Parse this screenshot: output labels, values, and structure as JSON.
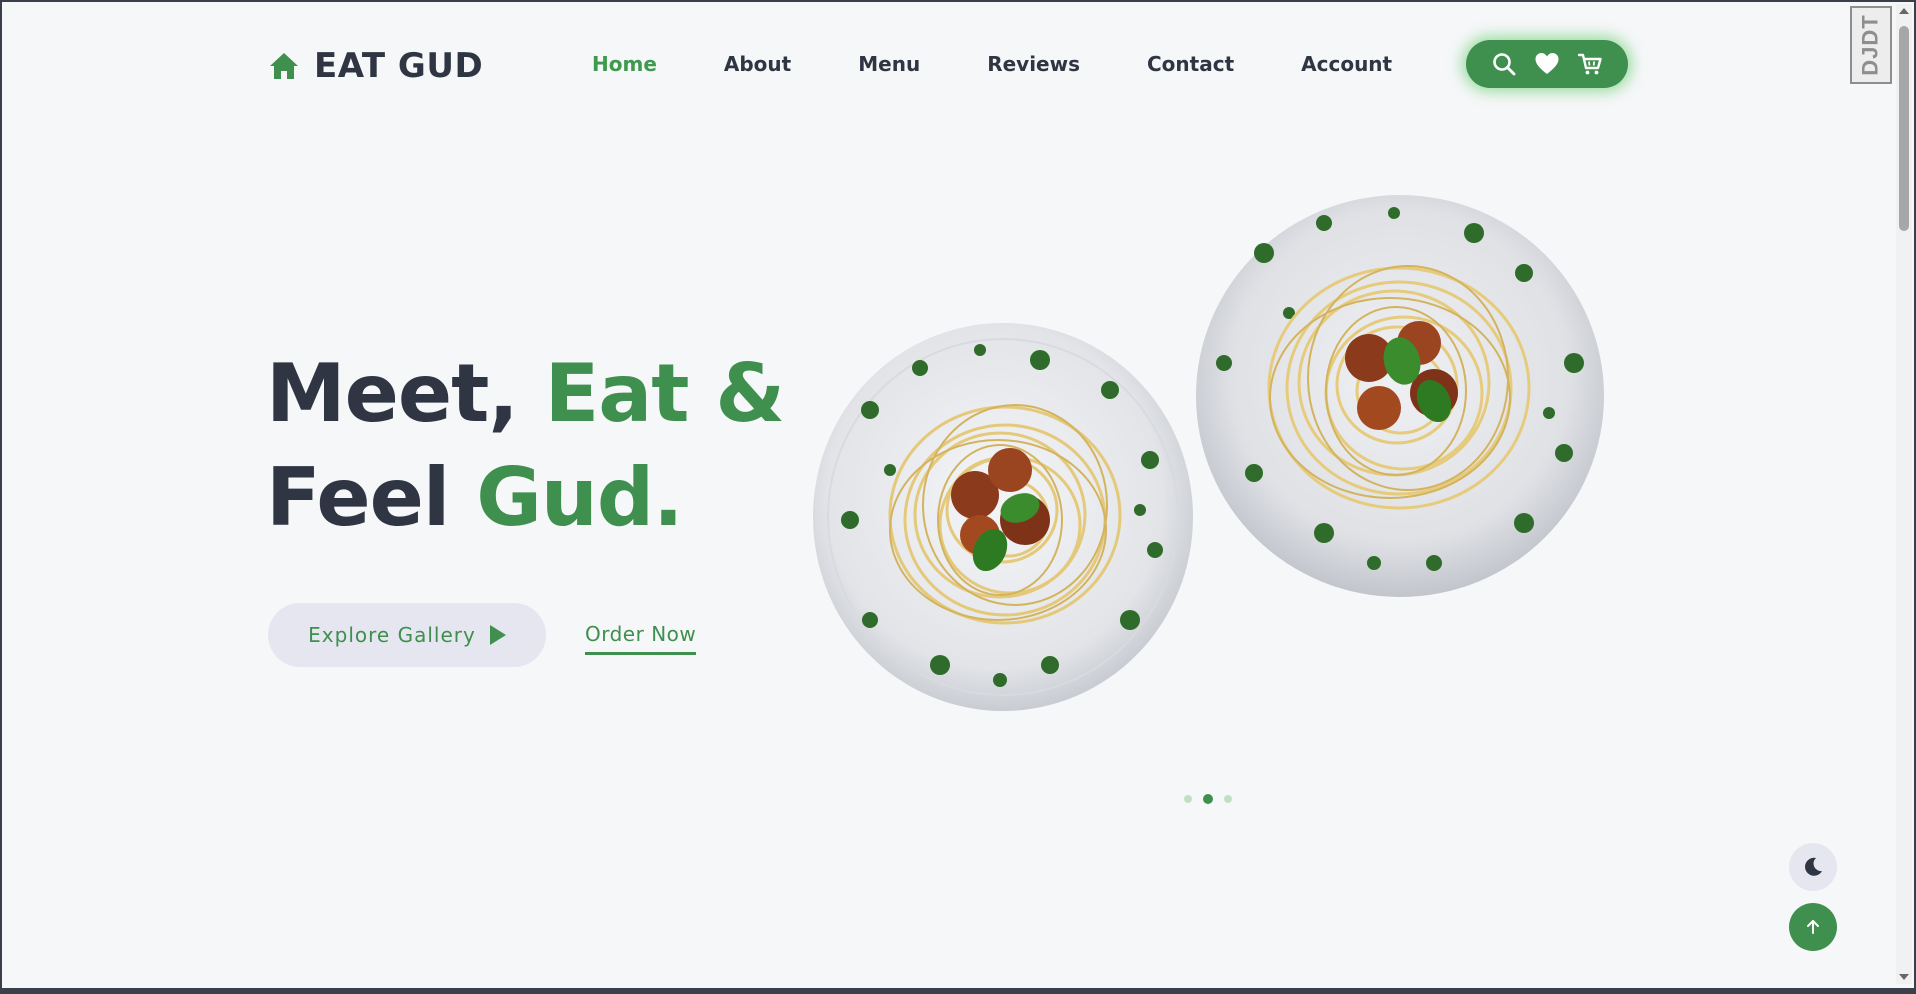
{
  "brand": {
    "name": "EAT GUD",
    "logo_icon": "home-icon",
    "accent_color": "#3f8f4e"
  },
  "nav": {
    "items": [
      {
        "label": "Home",
        "active": true
      },
      {
        "label": "About",
        "active": false
      },
      {
        "label": "Menu",
        "active": false
      },
      {
        "label": "Reviews",
        "active": false
      },
      {
        "label": "Contact",
        "active": false
      },
      {
        "label": "Account",
        "active": false
      }
    ]
  },
  "actions": [
    "search-icon",
    "heart-icon",
    "cart-icon"
  ],
  "hero": {
    "line1_dark": "Meet, ",
    "line1_green": "Eat &",
    "line2_dark": "Feel ",
    "line2_green": "Gud.",
    "explore_label": "Explore Gallery",
    "order_label": "Order Now"
  },
  "slider": {
    "slide_count": 3,
    "active_index": 1
  },
  "extension_badge": "DJDT",
  "floating": {
    "theme_icon": "moon-icon",
    "top_icon": "arrow-up-icon"
  }
}
